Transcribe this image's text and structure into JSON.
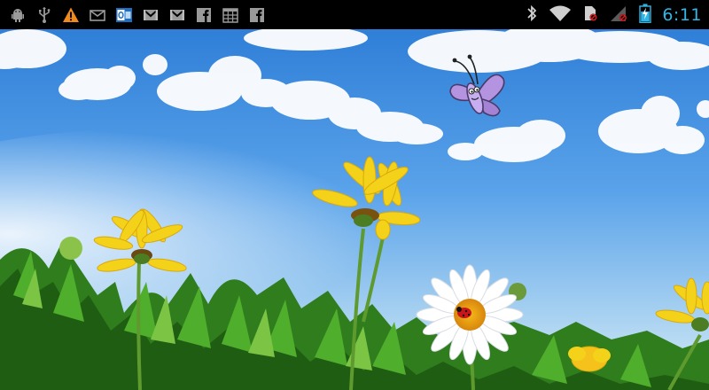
{
  "status_bar": {
    "time": "6:11",
    "notifications": [
      {
        "icon": "android-debug-icon"
      },
      {
        "icon": "usb-icon"
      },
      {
        "icon": "warning-icon"
      },
      {
        "icon": "email-icon"
      },
      {
        "icon": "outlook-icon"
      },
      {
        "icon": "gmail-icon"
      },
      {
        "icon": "gmail-icon"
      },
      {
        "icon": "facebook-icon"
      },
      {
        "icon": "calendar-grid-icon"
      },
      {
        "icon": "facebook-icon"
      }
    ],
    "system_icons": [
      "bluetooth-icon",
      "wifi-icon",
      "no-sim-icon",
      "no-signal-icon",
      "battery-charging-icon"
    ],
    "colors": {
      "accent": "#33b5e5",
      "warning": "#f08a1c",
      "outlook_blue": "#1e6fc2"
    }
  },
  "wallpaper": {
    "description_icon": "live-wallpaper-flowers",
    "colors": {
      "sky_top": "#2f7fd8",
      "sky_mid": "#5aa3ea",
      "sky_low": "#b9dcf4",
      "petal_yellow": "#f4d21a",
      "leaf_green": "#3f9a22"
    }
  }
}
